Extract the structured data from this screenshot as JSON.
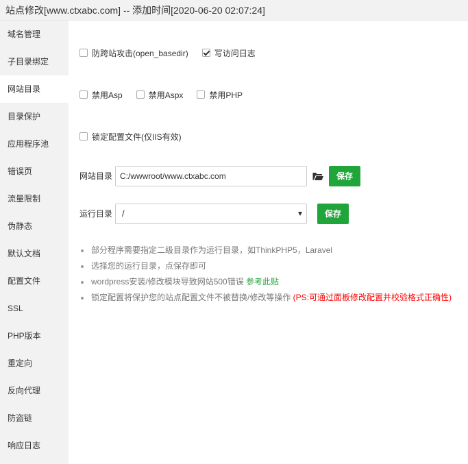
{
  "window": {
    "title": "站点修改[www.ctxabc.com] -- 添加时间[2020-06-20 02:07:24]"
  },
  "sidebar": {
    "items": [
      {
        "label": "域名管理"
      },
      {
        "label": "子目录绑定"
      },
      {
        "label": "网站目录",
        "active": true
      },
      {
        "label": "目录保护"
      },
      {
        "label": "应用程序池"
      },
      {
        "label": "错误页"
      },
      {
        "label": "流量限制"
      },
      {
        "label": "伪静态"
      },
      {
        "label": "默认文档"
      },
      {
        "label": "配置文件"
      },
      {
        "label": "SSL"
      },
      {
        "label": "PHP版本"
      },
      {
        "label": "重定向"
      },
      {
        "label": "反向代理"
      },
      {
        "label": "防盗链"
      },
      {
        "label": "响应日志"
      }
    ]
  },
  "options": {
    "open_basedir": {
      "label": "防跨站攻击(open_basedir)",
      "checked": false
    },
    "write_log": {
      "label": "写访问日志",
      "checked": true
    },
    "disable_asp": {
      "label": "禁用Asp",
      "checked": false
    },
    "disable_aspx": {
      "label": "禁用Aspx",
      "checked": false
    },
    "disable_php": {
      "label": "禁用PHP",
      "checked": false
    },
    "lock_config": {
      "label": "锁定配置文件(仅IIS有效)",
      "checked": false
    }
  },
  "site_dir": {
    "label": "网站目录",
    "value": "C:/wwwroot/www.ctxabc.com",
    "save_label": "保存"
  },
  "run_dir": {
    "label": "运行目录",
    "selected": "/",
    "save_label": "保存"
  },
  "help": {
    "item1": "部分程序需要指定二级目录作为运行目录，如ThinkPHP5，Laravel",
    "item2": "选择您的运行目录，点保存即可",
    "item3_text": "wordpress安装/修改模块导致网站500错误 ",
    "item3_link": "参考此贴",
    "item4_text": "锁定配置将保护您的站点配置文件不被替换/修改等操作 ",
    "item4_note": "(PS:可通过面板修改配置并校验格式正确性)"
  },
  "colors": {
    "accent_green": "#20a53a",
    "warning_red": "#ff0000",
    "sidebar_bg": "#f2f2f2"
  },
  "icons": {
    "folder": "folder-open-icon",
    "dropdown": "chevron-down-icon",
    "check": "check-icon"
  }
}
